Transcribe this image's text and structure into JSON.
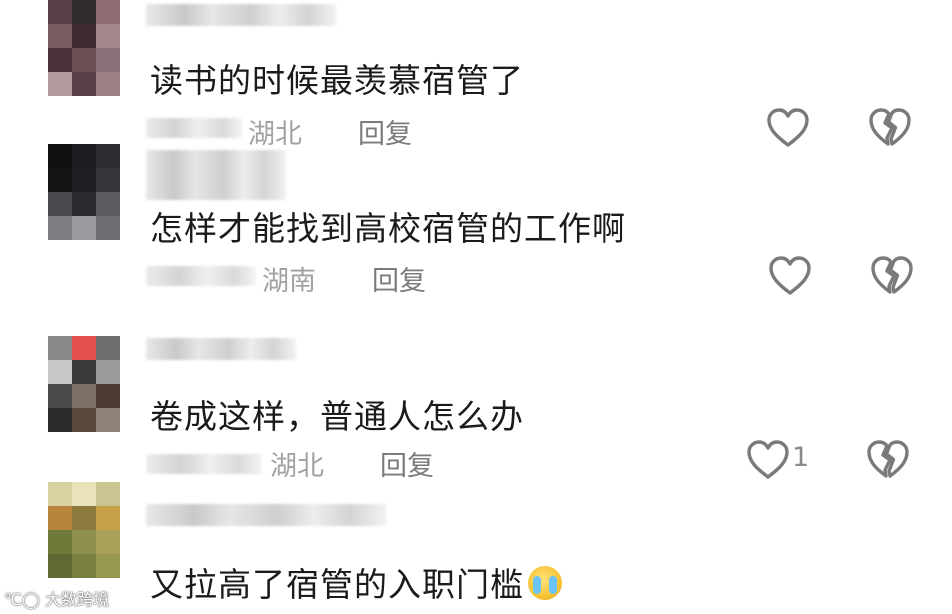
{
  "comments": [
    {
      "text": "读书的时候最羡慕宿管了",
      "location": "湖北",
      "reply_label": "回复",
      "like_count": "",
      "avatar_colors": [
        "#5a3e45",
        "#2e2a2d",
        "#8f6d74",
        "#7b5c62",
        "#3d2b30",
        "#a4858a",
        "#4a3439",
        "#6b4f55",
        "#8a7378",
        "#b09a9e",
        "#574048",
        "#9d8186"
      ]
    },
    {
      "text": "怎样才能找到高校宿管的工作啊",
      "location": "湖南",
      "reply_label": "回复",
      "like_count": "",
      "avatar_colors": [
        "#0f0f10",
        "#1c1d22",
        "#2b2c30",
        "#131416",
        "#1f2024",
        "#35363b",
        "#4a4b50",
        "#2a2b2f",
        "#5c5d62",
        "#7c7d80",
        "#9a9b9e",
        "#6d6e72"
      ]
    },
    {
      "text": "卷成这样，普通人怎么办",
      "location": "湖北",
      "reply_label": "回复",
      "like_count": "1",
      "avatar_colors": [
        "#8a8a8a",
        "#e2504c",
        "#6f6f6f",
        "#c8c8c8",
        "#3a3a3a",
        "#9a9a9a",
        "#4b4b4b",
        "#7a7066",
        "#4a3a30",
        "#2b2b2b",
        "#5a4a3e",
        "#8c8278"
      ]
    },
    {
      "text": "又拉高了宿管的入职门槛",
      "location": "",
      "reply_label": "",
      "like_count": "",
      "avatar_colors": [
        "#d8d2a0",
        "#e8e3b8",
        "#c9c590",
        "#b8863a",
        "#8f7a3e",
        "#c7a04a",
        "#6e7a3a",
        "#8d8f4e",
        "#a9a05a",
        "#5e6a32",
        "#7a7f42",
        "#96984f"
      ]
    }
  ],
  "icons": {
    "like": "heart-outline-icon",
    "dislike": "broken-heart-icon",
    "emoji": "crying-face-emoji"
  },
  "watermark": "大数跨境"
}
